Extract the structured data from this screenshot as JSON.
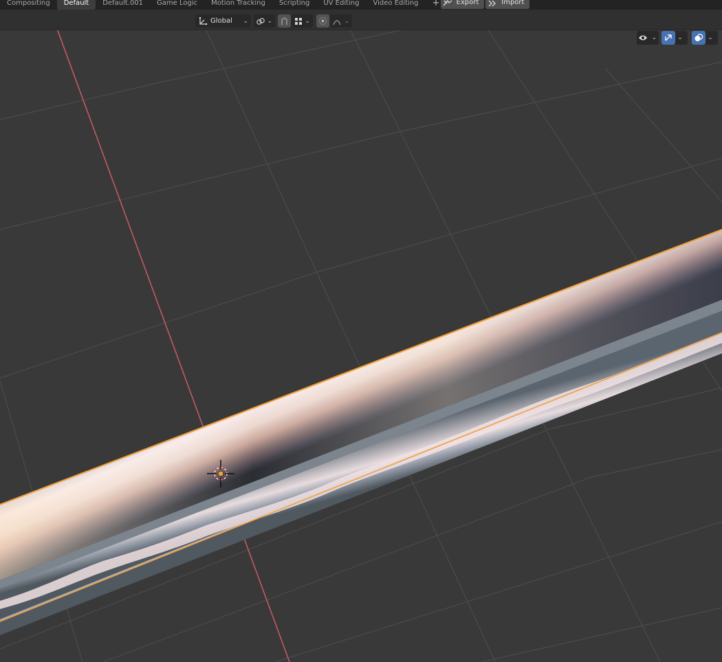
{
  "workspace_tabs": [
    {
      "label": "Compositing",
      "active": false
    },
    {
      "label": "Default",
      "active": true
    },
    {
      "label": "Default.001",
      "active": false
    },
    {
      "label": "Game Logic",
      "active": false
    },
    {
      "label": "Motion Tracking",
      "active": false
    },
    {
      "label": "Scripting",
      "active": false
    },
    {
      "label": "UV Editing",
      "active": false
    },
    {
      "label": "Video Editing",
      "active": false
    }
  ],
  "add_workspace_label": "+",
  "addon_buttons": {
    "export_label": "Export",
    "import_label": "Import"
  },
  "header": {
    "transform_orientation": "Global",
    "icons": {
      "orientation": "transform-orientation-icon",
      "pivot": "pivot-point-icon",
      "snap": "snap-magnet-icon",
      "snap_target": "snap-increment-icon",
      "proportional": "proportional-editing-icon",
      "falloff": "proportional-falloff-icon"
    }
  },
  "viewport_tools": {
    "visibility": "selectability-visibility-icon",
    "gizmo": "gizmo-toggle-icon",
    "overlays": "overlays-toggle-icon"
  },
  "colors": {
    "background": "#393939",
    "grid_line": "#4c4c4c",
    "x_axis": "#c0525a",
    "selection_outline": "#f3a13c",
    "active_blue": "#4772b3"
  }
}
